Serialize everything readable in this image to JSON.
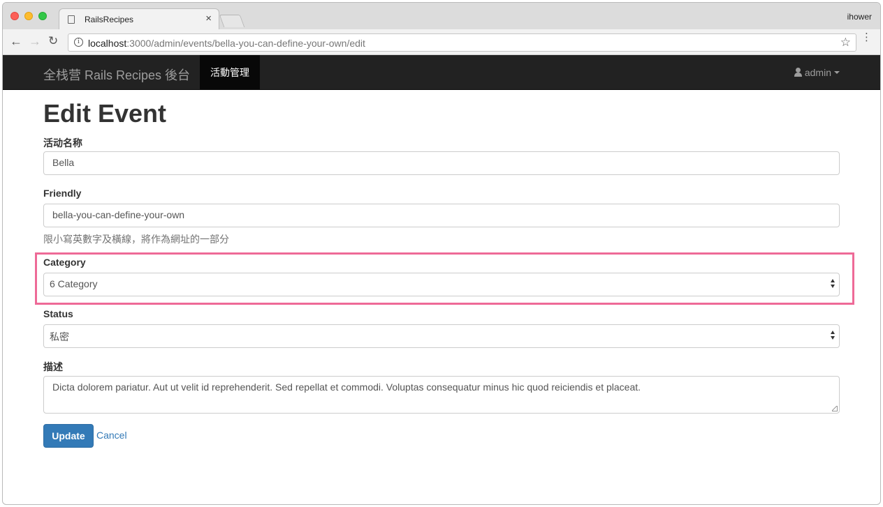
{
  "browser": {
    "tab_title": "RailsRecipes",
    "tab_close": "×",
    "profile_name": "ihower",
    "url_host": "localhost",
    "url_path": ":3000/admin/events/bella-you-can-define-your-own/edit",
    "back_glyph": "←",
    "forward_glyph": "→",
    "reload_glyph": "↻",
    "star_glyph": "☆",
    "menu_glyph": "⋮",
    "info_glyph": "i"
  },
  "navbar": {
    "brand": "全栈营 Rails Recipes 後台",
    "active_item": "活動管理",
    "user_label": "admin",
    "icons": [
      "user-icon",
      "caret-icon"
    ]
  },
  "page": {
    "title": "Edit Event"
  },
  "form": {
    "name_label": "活动名称",
    "name_value": "Bella",
    "friendly_label": "Friendly",
    "friendly_value": "bella-you-can-define-your-own",
    "friendly_help": "限小寫英數字及橫線，將作為網址的一部分",
    "category_label": "Category",
    "category_value": "6 Category",
    "status_label": "Status",
    "status_value": "私密",
    "description_label": "描述",
    "description_value": "Dicta dolorem pariatur. Aut ut velit id reprehenderit. Sed repellat et commodi. Voluptas consequatur minus hic quod reiciendis et placeat.",
    "update_button": "Update",
    "cancel_link": "Cancel"
  },
  "colors": {
    "navbar_bg": "#222222",
    "primary": "#337ab7",
    "highlight": "#ee6a97"
  }
}
